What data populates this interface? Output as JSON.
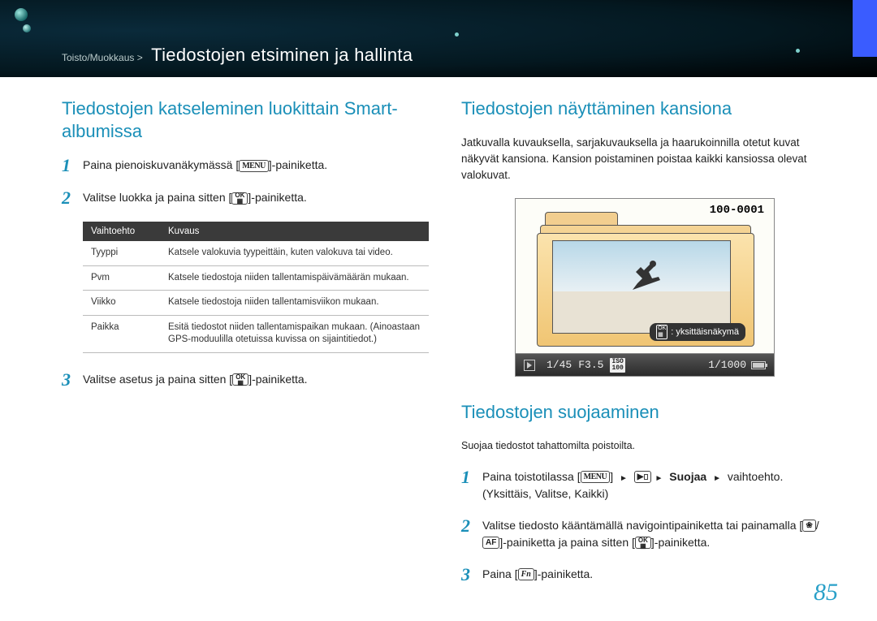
{
  "header": {
    "breadcrumb": "Toisto/Muokkaus >",
    "title": "Tiedostojen etsiminen ja hallinta"
  },
  "left": {
    "heading": "Tiedostojen katseleminen luokittain Smart-albumissa",
    "step1a": "Paina pienoiskuvanäkymässä [",
    "step1b": "]-painiketta.",
    "menu_label": "MENU",
    "step2a": "Valitse luokka ja paina sitten [",
    "step2b": "]-painiketta.",
    "ok_label": "OK",
    "table": {
      "head_opt": "Vaihtoehto",
      "head_desc": "Kuvaus",
      "rows": [
        {
          "opt": "Tyyppi",
          "desc": "Katsele valokuvia tyypeittäin, kuten valokuva tai video."
        },
        {
          "opt": "Pvm",
          "desc": "Katsele tiedostoja niiden tallentamispäivämäärän mukaan."
        },
        {
          "opt": "Viikko",
          "desc": "Katsele tiedostoja niiden tallentamisviikon mukaan."
        },
        {
          "opt": "Paikka",
          "desc": "Esitä tiedostot niiden tallentamispaikan mukaan. (Ainoastaan GPS-moduulilla otetuissa kuvissa on sijaintitiedot.)"
        }
      ]
    },
    "step3a": "Valitse asetus ja paina sitten [",
    "step3b": "]-painiketta."
  },
  "right": {
    "heading1": "Tiedostojen näyttäminen kansiona",
    "para1": "Jatkuvalla kuvauksella, sarjakuvauksella ja haarukoinnilla otetut kuvat näkyvät kansiona. Kansion poistaminen poistaa kaikki kansiossa olevat valokuvat.",
    "lcd": {
      "folder_num": "100-0001",
      "pill_text": ": yksittäisnäkymä",
      "bar_count": "1/45",
      "bar_f": "F3.5",
      "bar_iso_top": "ISO",
      "bar_iso_bot": "100",
      "bar_shutter": "1/1000"
    },
    "heading2": "Tiedostojen suojaaminen",
    "para2": "Suojaa tiedostot tahattomilta poistoilta.",
    "step1a": "Paina toistotilassa [",
    "step1b": "] ",
    "step1c": " Suojaa ",
    "step1d": " vaihtoehto. (Yksittäis, Valitse, Kaikki)",
    "tri": "►",
    "step2a": "Valitse tiedosto kääntämällä navigointipainiketta tai painamalla [",
    "step2b": "/",
    "step2c": "]-painiketta ja paina sitten [",
    "step2d": "]-painiketta.",
    "af_label": "AF",
    "flower": "❀",
    "step3a": "Paina [",
    "step3b": "]-painiketta.",
    "fn_label": "Fn"
  },
  "page_number": "85"
}
